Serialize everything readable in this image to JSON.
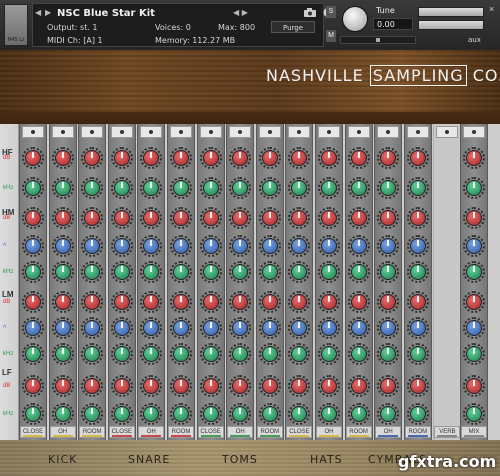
{
  "header": {
    "logo_text": "N45 Lz",
    "instrument_title": "NSC Blue Star Kit",
    "output_label": "Output: st. 1",
    "midi_label": "MIDI Ch: [A] 1",
    "voices_label": "Voices: 0",
    "max_label": "Max: 800",
    "memory_label": "Memory: 112.27 MB",
    "purge_label": "Purge",
    "solo_label": "S",
    "mute_label": "M",
    "tune_label": "Tune",
    "tune_value": "0.00",
    "aux_label": "aux",
    "close_glyph": "×",
    "prev_glyph": "◀",
    "next_glyph": "▶",
    "arrows_glyph": "◀ ▶"
  },
  "banner": {
    "brand_left": "NASHVILLE ",
    "brand_boxed": "SAMPLING",
    "brand_right": " CO."
  },
  "mixer": {
    "bands": [
      {
        "name": "HF",
        "units": [
          "dB",
          "kHz"
        ]
      },
      {
        "name": "HM",
        "units": [
          "dB",
          "^",
          "kHz"
        ]
      },
      {
        "name": "LM",
        "units": [
          "dB",
          "^",
          "kHz"
        ]
      },
      {
        "name": "LF",
        "units": [
          "dB",
          "kHz"
        ]
      }
    ],
    "channels": [
      {
        "label": "CLOSE",
        "accent": "#d4b84a"
      },
      {
        "label": "OH",
        "accent": "#d4b84a"
      },
      {
        "label": "ROOM",
        "accent": "#d4b84a"
      },
      {
        "label": "CLOSE",
        "accent": "#c94a4a"
      },
      {
        "label": "OH",
        "accent": "#c94a4a"
      },
      {
        "label": "ROOM",
        "accent": "#c94a4a"
      },
      {
        "label": "CLOSE",
        "accent": "#4a9a5a"
      },
      {
        "label": "OH",
        "accent": "#4a9a5a"
      },
      {
        "label": "ROOM",
        "accent": "#4a9a5a"
      },
      {
        "label": "CLOSE",
        "accent": "#d4b84a"
      },
      {
        "label": "OH",
        "accent": "#d4b84a"
      },
      {
        "label": "ROOM",
        "accent": "#d4b84a"
      },
      {
        "label": "OH",
        "accent": "#4a6ab0"
      },
      {
        "label": "ROOM",
        "accent": "#4a6ab0"
      },
      {
        "label": "VERB",
        "accent": "#888888"
      },
      {
        "label": "MIX",
        "accent": "#888888"
      }
    ]
  },
  "nav": {
    "tabs": [
      "KICK",
      "SNARE",
      "TOMS",
      "HATS",
      "CYMBALS"
    ]
  },
  "watermark": "gfxtra.com",
  "colors": {
    "knob_red": "#c0393b",
    "knob_green": "#2e9b63",
    "knob_blue": "#3b69b8",
    "wood_dark": "#4b2e14"
  }
}
